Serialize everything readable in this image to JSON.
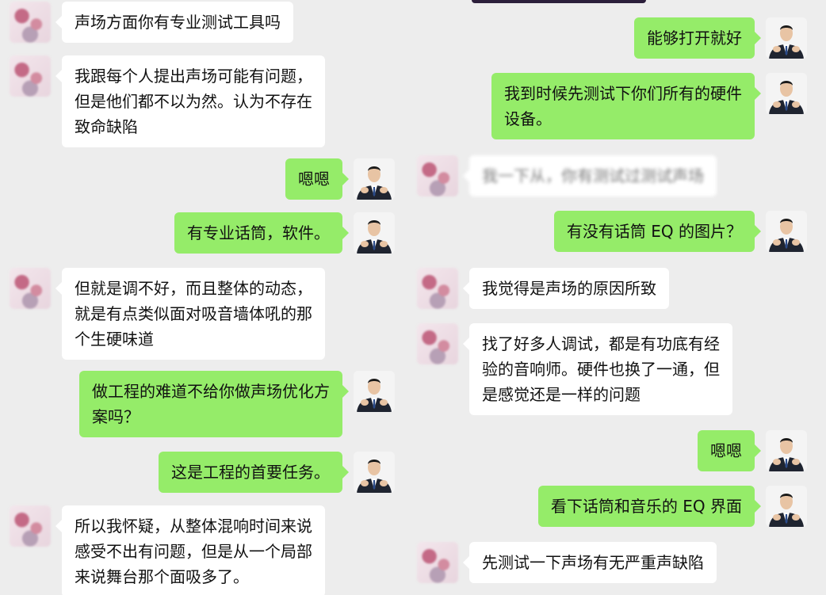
{
  "left_messages": [
    {
      "sender": "other",
      "text": "声场方面你有专业测试工具吗"
    },
    {
      "sender": "other",
      "text": "我跟每个人提出声场可能有问题，\n但是他们都不以为然。认为不存在\n致命缺陷"
    },
    {
      "sender": "me",
      "text": "嗯嗯"
    },
    {
      "sender": "me",
      "text": "有专业话筒，软件。"
    },
    {
      "sender": "other",
      "text": "但就是调不好，而且整体的动态，\n就是有点类似面对吸音墙体吼的那\n个生硬味道"
    },
    {
      "sender": "me",
      "text": "做工程的难道不给你做声场优化方\n案吗？"
    },
    {
      "sender": "me",
      "text": "这是工程的首要任务。"
    },
    {
      "sender": "other",
      "text": "所以我怀疑，从整体混响时间来说\n感受不出有问题，但是从一个局部\n来说舞台那个面吸多了。"
    }
  ],
  "right_messages": [
    {
      "sender": "me",
      "text": "能够打开就好"
    },
    {
      "sender": "me",
      "text": "我到时候先测试下你们所有的硬件\n设备。"
    },
    {
      "sender": "other",
      "text": "我一下从，你有测试过测试声场",
      "blurred": true
    },
    {
      "sender": "me",
      "text": "有没有话筒 EQ 的图片？"
    },
    {
      "sender": "other",
      "text": "我觉得是声场的原因所致"
    },
    {
      "sender": "other",
      "text": "找了好多人调试，都是有功底有经\n验的音响师。硬件也换了一通，但\n是感觉还是一样的问题"
    },
    {
      "sender": "me",
      "text": "嗯嗯"
    },
    {
      "sender": "me",
      "text": "看下话筒和音乐的 EQ 界面"
    },
    {
      "sender": "other",
      "text": "先测试一下声场有无严重声缺陷"
    }
  ]
}
